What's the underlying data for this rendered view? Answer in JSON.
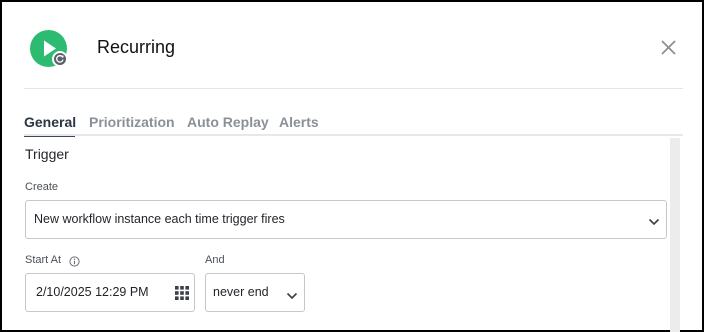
{
  "dialog": {
    "title": "Recurring",
    "app_icon": "play-icon",
    "badge_icon": "repeat-icon",
    "close_icon": "close-icon"
  },
  "tabs": [
    {
      "label": "General",
      "active": true
    },
    {
      "label": "Prioritization",
      "active": false
    },
    {
      "label": "Auto Replay",
      "active": false
    },
    {
      "label": "Alerts",
      "active": false
    }
  ],
  "trigger": {
    "section_title": "Trigger",
    "create_label": "Create",
    "create_value": "New workflow instance each time trigger fires",
    "start_label": "Start At",
    "start_value": "2/10/2025 12:29 PM",
    "and_label": "And",
    "and_value": "never end"
  },
  "colors": {
    "accent_green": "#2dbb72",
    "tab_active": "#2a3642",
    "tab_inactive": "#8a9097"
  }
}
